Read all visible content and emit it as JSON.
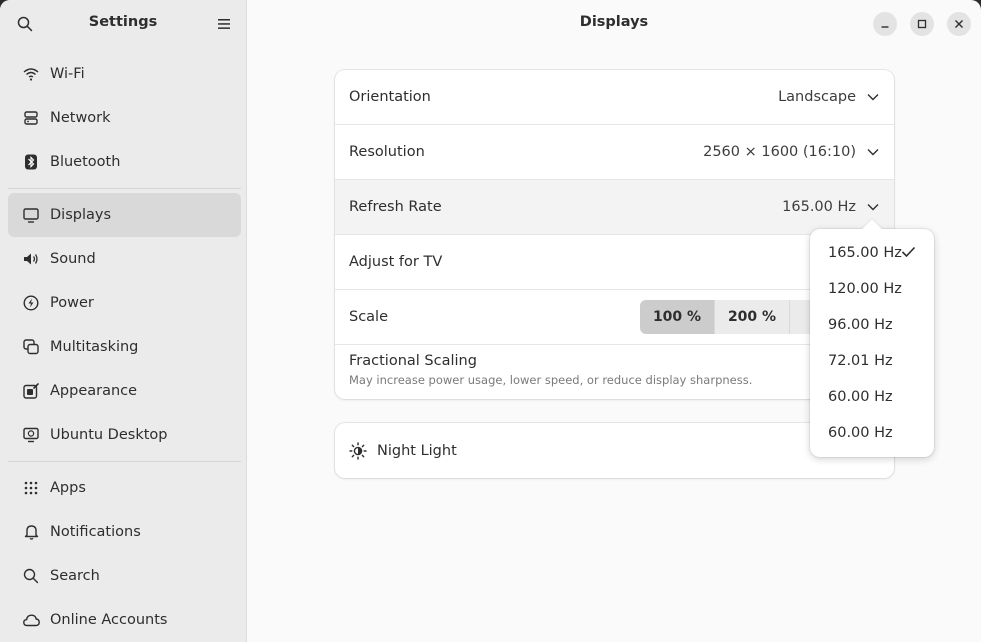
{
  "sidebar": {
    "title": "Settings",
    "groups": [
      [
        {
          "label": "Wi-Fi",
          "icon": "wifi-icon"
        },
        {
          "label": "Network",
          "icon": "network-icon"
        },
        {
          "label": "Bluetooth",
          "icon": "bluetooth-icon"
        }
      ],
      [
        {
          "label": "Displays",
          "icon": "display-icon",
          "active": true
        },
        {
          "label": "Sound",
          "icon": "speaker-icon"
        },
        {
          "label": "Power",
          "icon": "power-icon"
        },
        {
          "label": "Multitasking",
          "icon": "multitasking-icon"
        },
        {
          "label": "Appearance",
          "icon": "appearance-icon"
        },
        {
          "label": "Ubuntu Desktop",
          "icon": "ubuntu-desktop-icon"
        }
      ],
      [
        {
          "label": "Apps",
          "icon": "apps-grid-icon"
        },
        {
          "label": "Notifications",
          "icon": "bell-icon"
        },
        {
          "label": "Search",
          "icon": "search-icon"
        },
        {
          "label": "Online Accounts",
          "icon": "cloud-icon"
        }
      ]
    ]
  },
  "main": {
    "title": "Displays",
    "settings": {
      "orientation": {
        "label": "Orientation",
        "value": "Landscape"
      },
      "resolution": {
        "label": "Resolution",
        "value": "2560 × 1600 (16:10)"
      },
      "refresh_rate": {
        "label": "Refresh Rate",
        "value": "165.00 Hz"
      },
      "adjust_tv": {
        "label": "Adjust for TV"
      },
      "scale": {
        "label": "Scale",
        "options": [
          "100 %",
          "200 %"
        ],
        "selected": "100 %"
      },
      "fractional_scaling": {
        "label": "Fractional Scaling",
        "subtitle": "May increase power usage, lower speed, or reduce display sharpness."
      }
    },
    "night_light": {
      "label": "Night Light"
    }
  },
  "refresh_popover": {
    "options": [
      "165.00 Hz",
      "120.00 Hz",
      "96.00 Hz",
      "72.01 Hz",
      "60.00 Hz",
      "60.00 Hz"
    ],
    "selected_index": 0
  },
  "colors": {
    "sidebar_bg": "#ebebeb",
    "sidebar_active": "#d9d9d9",
    "window_bg": "#fafafa",
    "card_bg": "#ffffff"
  }
}
